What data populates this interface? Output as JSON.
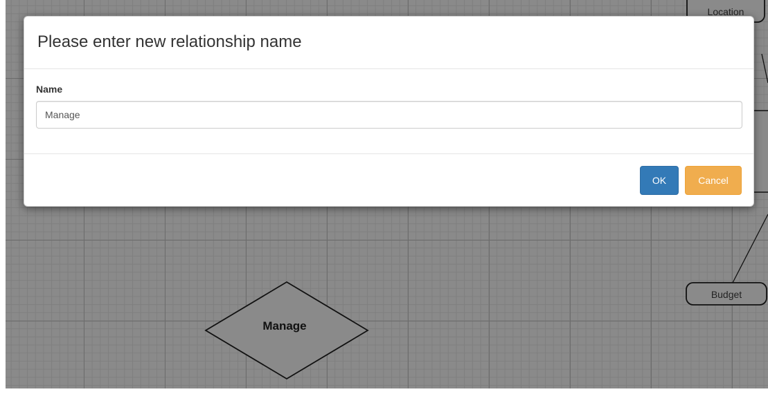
{
  "diagram": {
    "entities": [
      {
        "label": "Location"
      },
      {
        "label": "Budget"
      }
    ],
    "relationship": {
      "label": "Manage"
    }
  },
  "modal": {
    "title": "Please enter new relationship name",
    "field_label": "Name",
    "input_value": "Manage",
    "ok_label": "OK",
    "cancel_label": "Cancel"
  },
  "colors": {
    "primary": "#337ab7",
    "warning": "#f0ad4e",
    "canvas": "#8a8a8a"
  }
}
